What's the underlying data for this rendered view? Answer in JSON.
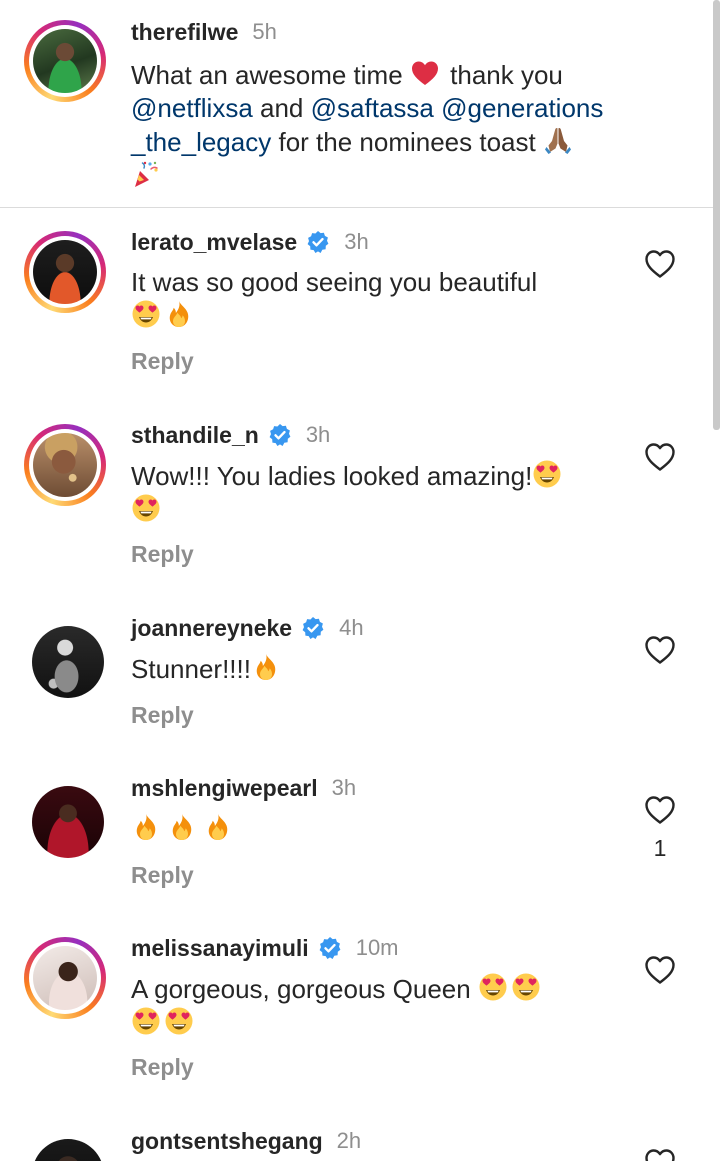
{
  "caption": {
    "username": "therefilwe",
    "time": "5h",
    "line1_a": "What an awesome time",
    "line1_b": "thank you",
    "mention1": "@netflixsa",
    "and": "and",
    "mention2": "@saftassa",
    "mention3": "@generations",
    "mention3_cont": "_the_legacy",
    "tail": "for the nominees toast"
  },
  "reply_label": "Reply",
  "comments": [
    {
      "username": "lerato_mvelase",
      "verified": true,
      "time": "3h",
      "text": "It was so good seeing you beautiful",
      "emojis": [
        "heart-eyes",
        "fire"
      ],
      "likes": ""
    },
    {
      "username": "sthandile_n",
      "verified": true,
      "time": "3h",
      "text": "Wow!!! You ladies looked amazing!",
      "emojis": [
        "heart-eyes",
        "heart-eyes"
      ],
      "likes": ""
    },
    {
      "username": "joannereyneke",
      "verified": true,
      "time": "4h",
      "text": "Stunner!!!!",
      "emojis": [
        "fire"
      ],
      "likes": ""
    },
    {
      "username": "mshlengiwepearl",
      "verified": false,
      "time": "3h",
      "text": "",
      "emojis": [
        "fire",
        "fire",
        "fire"
      ],
      "likes": "1"
    },
    {
      "username": "melissanayimuli",
      "verified": true,
      "time": "10m",
      "text": "A gorgeous, gorgeous Queen",
      "emojis": [
        "heart-eyes",
        "heart-eyes",
        "heart-eyes",
        "heart-eyes"
      ],
      "likes": ""
    },
    {
      "username": "gontsentshegang",
      "verified": false,
      "time": "2h",
      "text": "",
      "emojis": [],
      "likes": ""
    }
  ],
  "colors": {
    "text": "#262626",
    "muted": "#8e8e8e",
    "mention": "#00376b",
    "verified": "#3897f0",
    "divider": "#dbdbdb"
  },
  "icons": {
    "verified": "verified-badge-icon",
    "like": "heart-outline-icon",
    "red_heart": "red-heart-emoji",
    "praying_hands": "praying-hands-emoji",
    "party_popper": "party-popper-emoji",
    "fire": "fire-emoji",
    "heart_eyes": "heart-eyes-emoji"
  }
}
